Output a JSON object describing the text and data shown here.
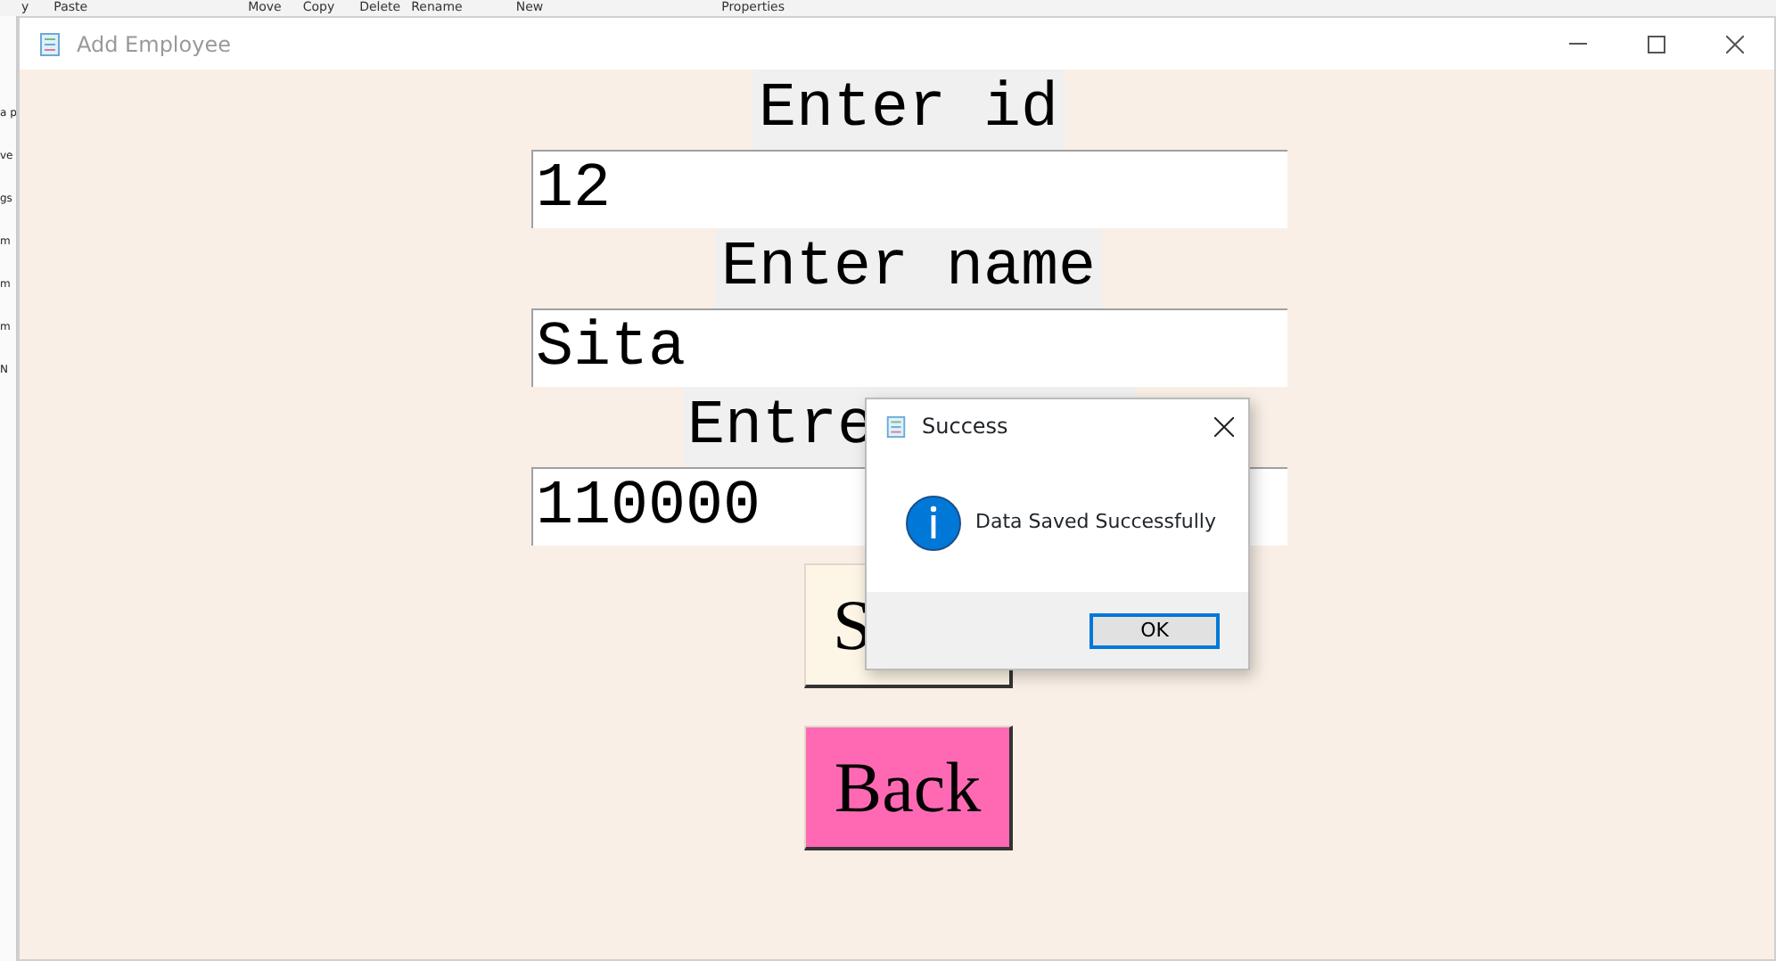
{
  "background_window": {
    "toolbar_labels": [
      "y",
      "Paste",
      "Move",
      "Copy",
      "Delete",
      "Rename",
      "New",
      "Properties"
    ],
    "sidebar_fragments": [
      "a p",
      "ve",
      "gs",
      "m",
      "m",
      "m",
      "N"
    ]
  },
  "window": {
    "title": "Add Employee"
  },
  "form": {
    "fields": [
      {
        "label": "Enter id",
        "value": "12"
      },
      {
        "label": "Enter name",
        "value": "Sita"
      },
      {
        "label": "Entre",
        "value": "110000"
      }
    ],
    "buttons": [
      {
        "kind": "save",
        "label": "S"
      },
      {
        "kind": "back",
        "label": "Back"
      }
    ]
  },
  "dialog": {
    "title": "Success",
    "message": "Data Saved Successfully",
    "button": "OK"
  }
}
